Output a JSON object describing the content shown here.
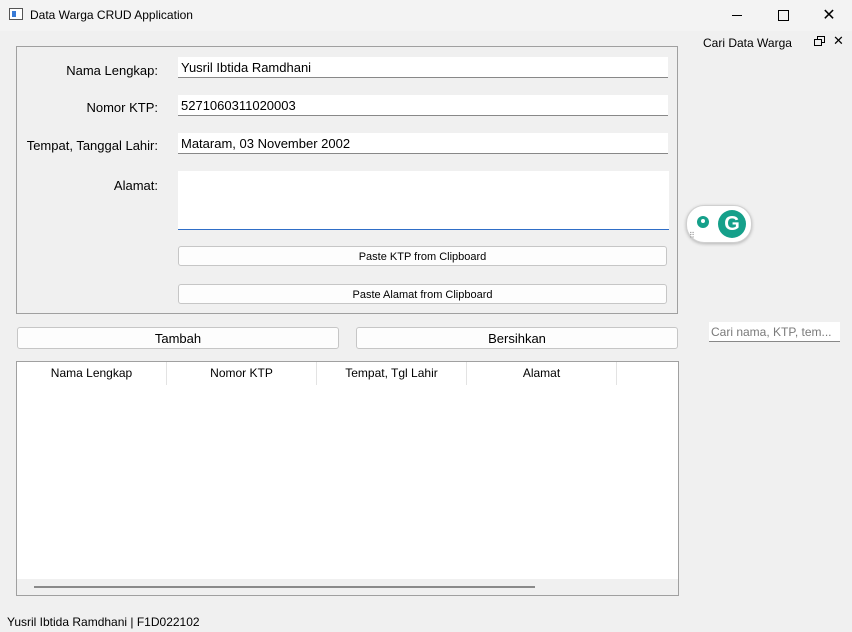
{
  "window": {
    "title": "Data Warga CRUD Application",
    "close_glyph": "✕"
  },
  "form": {
    "nama_label": "Nama Lengkap:",
    "nama_value": "Yusril Ibtida Ramdhani",
    "ktp_label": "Nomor KTP:",
    "ktp_value": "5271060311020003",
    "ttl_label": "Tempat, Tanggal Lahir:",
    "ttl_value": "Mataram, 03 November 2002",
    "alamat_label": "Alamat:",
    "alamat_value": "",
    "paste_ktp_label": "Paste KTP from Clipboard",
    "paste_alamat_label": "Paste Alamat from Clipboard"
  },
  "actions": {
    "tambah_label": "Tambah",
    "bersihkan_label": "Bersihkan"
  },
  "table": {
    "columns": [
      "Nama Lengkap",
      "Nomor KTP",
      "Tempat, Tgl Lahir",
      "Alamat"
    ],
    "rows": []
  },
  "dock": {
    "title": "Cari Data Warga",
    "close_glyph": "✕",
    "search_placeholder": "Cari nama, KTP, tem...",
    "search_value": ""
  },
  "grammarly": {
    "logo_letter": "G",
    "grip": "⠿"
  },
  "status_bar": {
    "text": "Yusril Ibtida Ramdhani | F1D022102"
  },
  "icons": {
    "app": "app-window-icon",
    "minimize": "minimize-icon",
    "maximize": "maximize-icon",
    "close": "close-icon",
    "float": "float-dock-icon",
    "bulb": "lightbulb-icon"
  }
}
